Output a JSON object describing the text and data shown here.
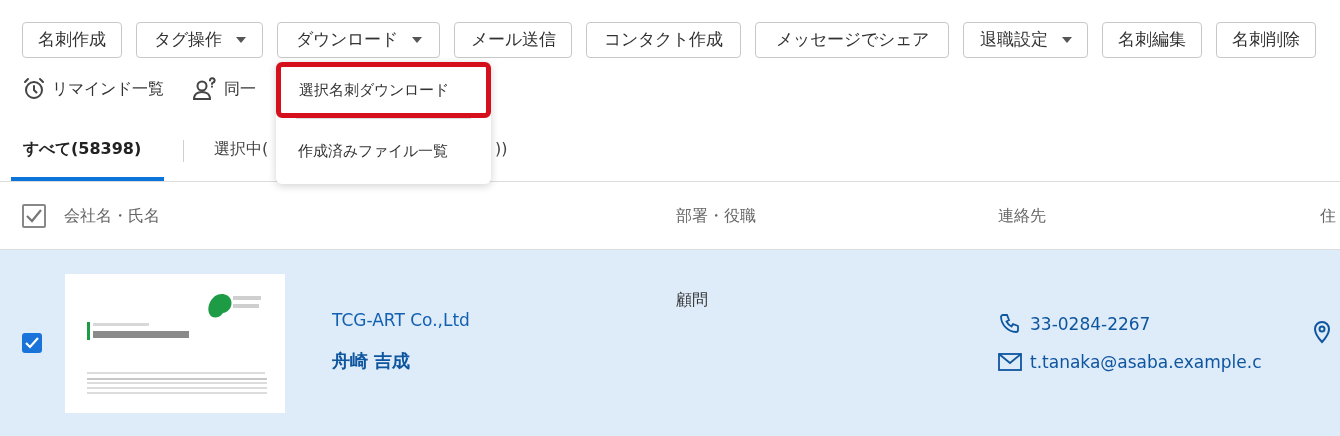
{
  "toolbar": [
    {
      "label": "名刺作成",
      "dropdown": false
    },
    {
      "label": "タグ操作",
      "dropdown": true
    },
    {
      "label": "ダウンロード",
      "dropdown": true
    },
    {
      "label": "メール送信",
      "dropdown": false
    },
    {
      "label": "コンタクト作成",
      "dropdown": false
    },
    {
      "label": "メッセージでシェア",
      "dropdown": false
    },
    {
      "label": "退職設定",
      "dropdown": true
    },
    {
      "label": "名刺編集",
      "dropdown": false
    },
    {
      "label": "名刺削除",
      "dropdown": false
    }
  ],
  "links": [
    {
      "kind": "alarm",
      "label": "リマインド一覧"
    },
    {
      "kind": "person",
      "label": "同一"
    }
  ],
  "tabs": [
    {
      "label": "すべて(58398)",
      "selected": true
    },
    {
      "label": "選択中(",
      "tail": "))",
      "selected": false
    }
  ],
  "dropdown_menu": [
    {
      "label": "選択名刺ダウンロード",
      "highlighted": true
    },
    {
      "label": "作成済みファイル一覧",
      "highlighted": false
    }
  ],
  "table": {
    "header_checked": true,
    "columns": [
      "会社名・氏名",
      "部署・役職",
      "連絡先",
      "住"
    ],
    "rows": [
      {
        "selected": true,
        "checked": true,
        "company": "TCG-ART Co.,Ltd",
        "name": "舟崎 吉成",
        "title": "顧問",
        "phone": "33-0284-2267",
        "email": "t.tanaka@asaba.example.c"
      }
    ]
  }
}
